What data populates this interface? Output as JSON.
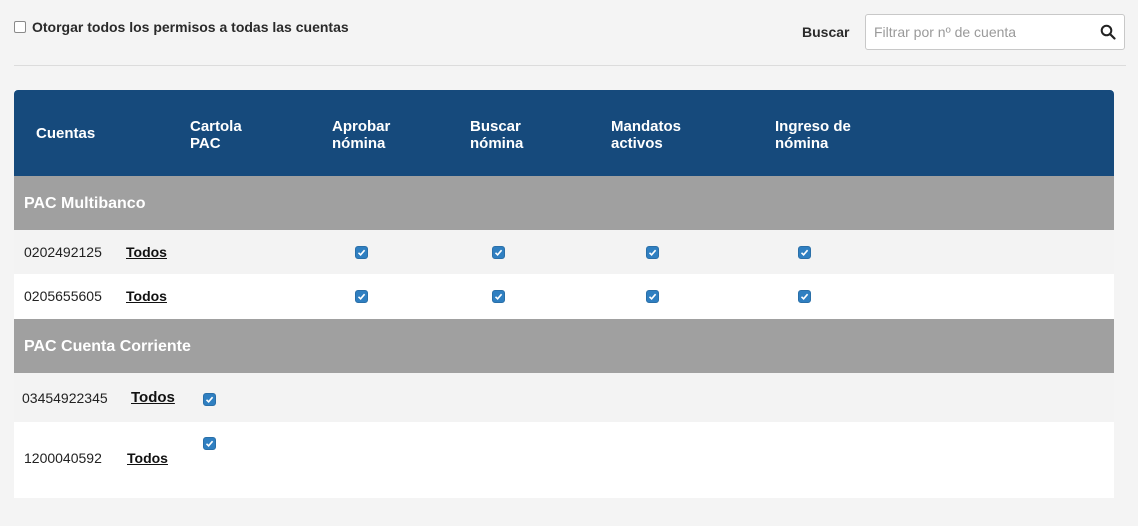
{
  "top": {
    "grant_all_label": "Otorgar todos los permisos a todas las cuentas",
    "grant_all_checked": false,
    "search_label": "Buscar",
    "search_placeholder": "Filtrar por nº de cuenta",
    "search_value": ""
  },
  "table": {
    "columns": [
      "Cuentas",
      "Cartola\nPAC",
      "Aprobar\nnómina",
      "Buscar\nnómina",
      "Mandatos\nactivos",
      "Ingreso de\nnómina"
    ],
    "groups": [
      {
        "title": "PAC Multibanco",
        "rows": [
          {
            "account": "0202492125",
            "todos": "Todos",
            "checks": [
              false,
              true,
              true,
              true,
              true
            ]
          },
          {
            "account": "0205655605",
            "todos": "Todos",
            "checks": [
              false,
              true,
              true,
              true,
              true
            ]
          }
        ]
      },
      {
        "title": "PAC Cuenta Corriente",
        "rows": [
          {
            "account": "03454922345",
            "todos": "Todos",
            "checks": [
              true,
              false,
              false,
              false,
              false
            ]
          },
          {
            "account": "1200040592",
            "todos": "Todos",
            "checks": [
              true,
              false,
              false,
              false,
              false
            ]
          }
        ]
      }
    ]
  },
  "colors": {
    "header_bg": "#164a7c",
    "group_bg": "#a0a0a0",
    "checkbox_checked": "#2f7fc1"
  }
}
